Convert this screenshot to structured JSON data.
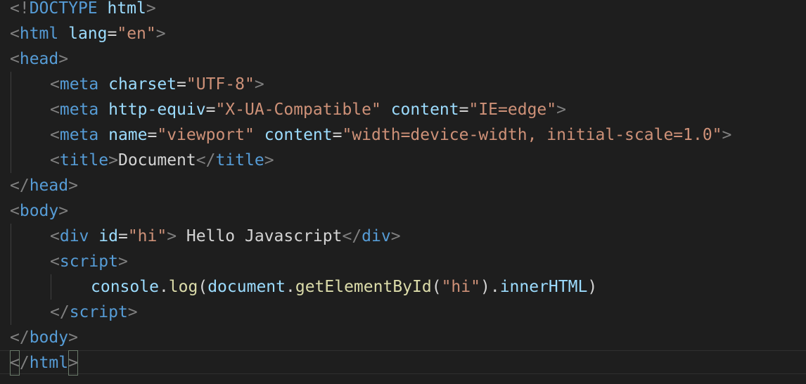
{
  "editor": {
    "language": "html",
    "colors": {
      "background": "#1e1e1e",
      "tag": "#569cd6",
      "attribute": "#9cdcfe",
      "string": "#ce9178",
      "punctuation": "#808080",
      "function": "#dcdcaa",
      "text": "#d4d4d4"
    },
    "tokens": {
      "doctype_open": "<!",
      "doctype_kw": "DOCTYPE",
      "doctype_val": " html",
      "lt": "<",
      "gt": ">",
      "lt_slash": "</",
      "eq": "=",
      "html": "html",
      "lang_attr": " lang",
      "lang_val": "\"en\"",
      "head": "head",
      "meta": "meta",
      "charset_attr": " charset",
      "charset_val": "\"UTF-8\"",
      "http_equiv_attr": " http-equiv",
      "http_equiv_val": "\"X-UA-Compatible\"",
      "content_attr": " content",
      "content_val_ie": "\"IE=edge\"",
      "name_attr": " name",
      "name_val": "\"viewport\"",
      "content_val_vp": "\"width=device-width, initial-scale=1.0\"",
      "title": "title",
      "title_text": "Document",
      "body": "body",
      "div": "div",
      "id_attr": " id",
      "id_val": "\"hi\"",
      "div_text": " Hello Javascript",
      "script": "script",
      "console": "console",
      "dot": ".",
      "log": "log",
      "paren_open": "(",
      "paren_close": ")",
      "document": "document",
      "getElementById": "getElementById",
      "hi_arg": "\"hi\"",
      "innerHTML": "innerHTML"
    }
  }
}
